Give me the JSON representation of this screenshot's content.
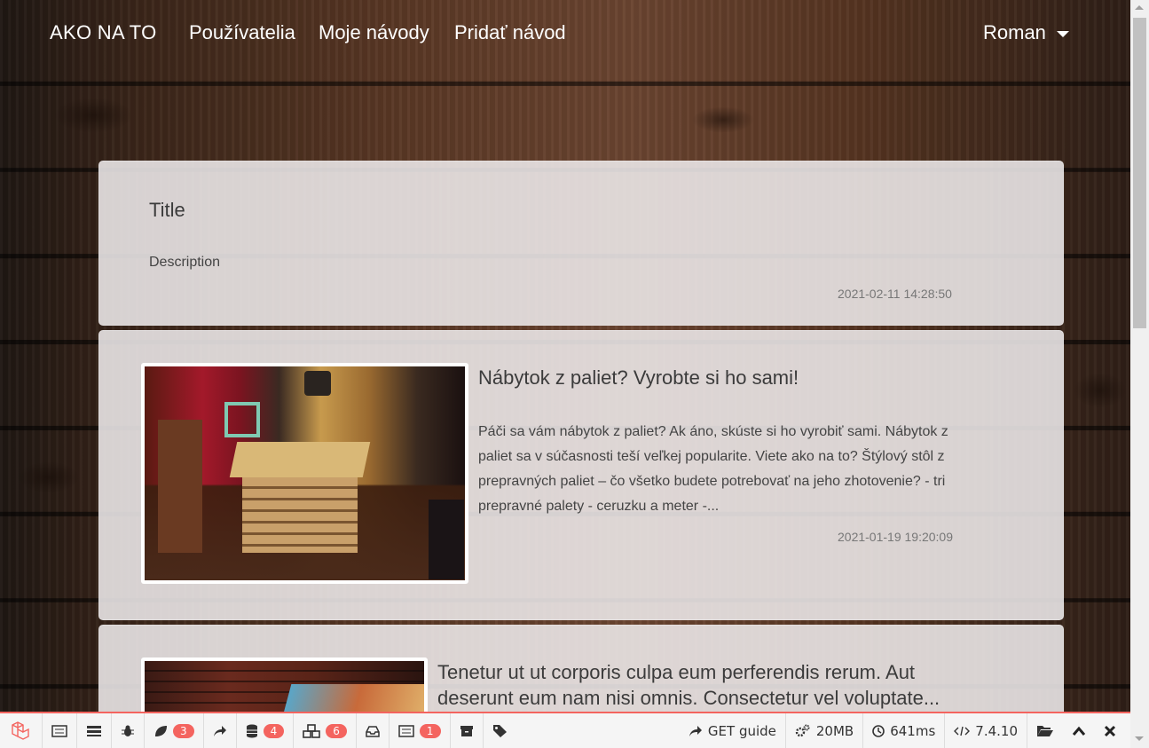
{
  "navbar": {
    "brand": "AKO NA TO",
    "links": [
      "Používatelia",
      "Moje návody",
      "Pridať návod"
    ],
    "user": "Roman"
  },
  "cards": [
    {
      "title": "Title",
      "description": "Description",
      "date": "2021-02-11 14:28:50"
    },
    {
      "title": "Nábytok z paliet? Vyrobte si ho sami!",
      "description": "Páči sa vám nábytok z paliet? Ak áno, skúste si ho vyrobiť sami. Nábytok z paliet sa v súčasnosti teší veľkej popularite. Viete ako na to? Štýlový stôl z prepravných paliet – čo všetko budete potrebovať na jeho zhotovenie? - tri prepravné palety - ceruzku a meter -...",
      "date": "2021-01-19 19:20:09"
    },
    {
      "title": "Tenetur ut ut corporis culpa eum perferendis rerum. Aut deserunt eum nam nisi omnis. Consectetur vel voluptate..."
    }
  ],
  "debugbar": {
    "badges": {
      "timeline": "3",
      "queries": "4",
      "models": "6",
      "mails": "1"
    },
    "request": "GET guide",
    "memory": "20MB",
    "time": "641ms",
    "php_version": "7.4.10"
  },
  "colors": {
    "accent": "#f4645f",
    "card_bg": "#eeeaec"
  }
}
